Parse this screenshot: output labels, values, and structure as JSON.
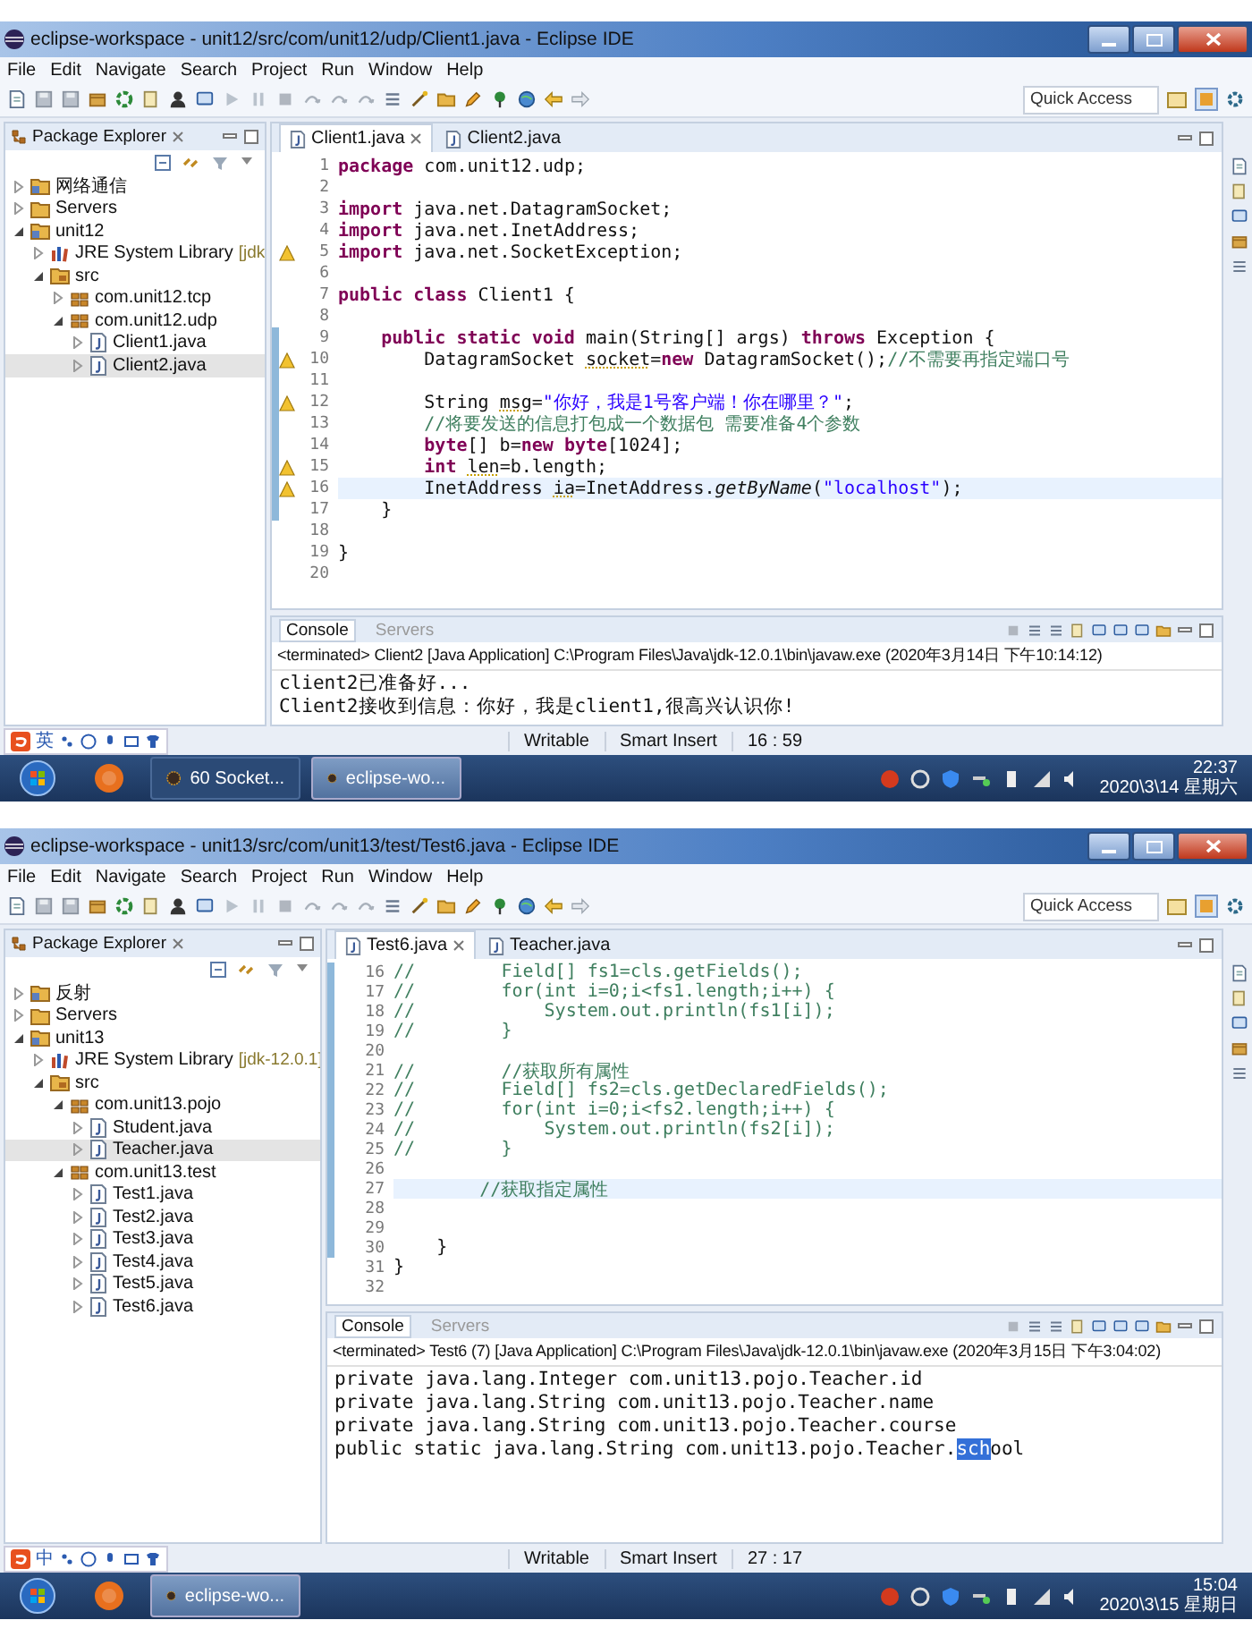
{
  "screens": [
    {
      "window": {
        "title": "eclipse-workspace - unit12/src/com/unit12/udp/Client1.java - Eclipse IDE"
      },
      "menu": [
        "File",
        "Edit",
        "Navigate",
        "Search",
        "Project",
        "Run",
        "Window",
        "Help"
      ],
      "quick_access": {
        "placeholder": "Quick Access"
      },
      "package_explorer": {
        "title": "Package Explorer",
        "tree": [
          {
            "label": "网络通信",
            "kind": "project",
            "expanded": false,
            "selected": false
          },
          {
            "label": "Servers",
            "kind": "folder",
            "expanded": false,
            "selected": false
          },
          {
            "label": "unit12",
            "kind": "project",
            "expanded": true,
            "selected": false,
            "children": [
              {
                "label": "JRE System Library",
                "decoration": "[jdk",
                "kind": "library",
                "expanded": false,
                "selected": false
              },
              {
                "label": "src",
                "kind": "source",
                "expanded": true,
                "selected": false,
                "children": [
                  {
                    "label": "com.unit12.tcp",
                    "kind": "package",
                    "expanded": false,
                    "selected": false
                  },
                  {
                    "label": "com.unit12.udp",
                    "kind": "package",
                    "expanded": true,
                    "selected": false,
                    "children": [
                      {
                        "label": "Client1.java",
                        "kind": "file",
                        "expanded": false,
                        "selected": false
                      },
                      {
                        "label": "Client2.java",
                        "kind": "file",
                        "expanded": false,
                        "selected": true
                      }
                    ]
                  }
                ]
              }
            ]
          }
        ]
      },
      "editor": {
        "tabs": [
          {
            "label": "Client1.java",
            "selected": true
          },
          {
            "label": "Client2.java",
            "selected": false
          }
        ],
        "lines": [
          {
            "n": "1",
            "warning": false,
            "changed": false,
            "selected": false,
            "tokens": [
              {
                "kind": "kw",
                "text": "package"
              },
              {
                "kind": "plain",
                "text": " com.unit12.udp;"
              }
            ]
          },
          {
            "n": "2",
            "warning": false,
            "changed": false,
            "selected": false
          },
          {
            "n": "3",
            "warning": false,
            "changed": false,
            "selected": false,
            "tokens": [
              {
                "kind": "kw",
                "text": "import"
              },
              {
                "kind": "plain",
                "text": " java.net.DatagramSocket;"
              }
            ]
          },
          {
            "n": "4",
            "warning": false,
            "changed": false,
            "selected": false,
            "tokens": [
              {
                "kind": "kw",
                "text": "import"
              },
              {
                "kind": "plain",
                "text": " java.net.InetAddress;"
              }
            ]
          },
          {
            "n": "5",
            "warning": true,
            "changed": false,
            "selected": false,
            "tokens": [
              {
                "kind": "kw",
                "text": "import"
              },
              {
                "kind": "plain",
                "text": " java.net.SocketException;"
              }
            ]
          },
          {
            "n": "6",
            "warning": false,
            "changed": false,
            "selected": false
          },
          {
            "n": "7",
            "warning": false,
            "changed": false,
            "selected": false,
            "tokens": [
              {
                "kind": "kw",
                "text": "public class"
              },
              {
                "kind": "plain",
                "text": " Client1 {"
              }
            ]
          },
          {
            "n": "8",
            "warning": false,
            "changed": false,
            "selected": false
          },
          {
            "n": "9",
            "warning": false,
            "changed": true,
            "selected": false,
            "tokens": [
              {
                "kind": "kw",
                "text": "    public static void"
              },
              {
                "kind": "plain",
                "text": " main(String[] args) "
              },
              {
                "kind": "kw",
                "text": "throws"
              },
              {
                "kind": "plain",
                "text": " Exception {"
              }
            ]
          },
          {
            "n": "10",
            "warning": true,
            "changed": true,
            "selected": false,
            "tokens": [
              {
                "kind": "plain",
                "text": "        DatagramSocket "
              },
              {
                "kind": "unused",
                "text": "socket"
              },
              {
                "kind": "plain",
                "text": "="
              },
              {
                "kind": "kw",
                "text": "new"
              },
              {
                "kind": "plain",
                "text": " DatagramSocket();"
              },
              {
                "kind": "comment",
                "text": "//不需要再指定端口号"
              }
            ]
          },
          {
            "n": "11",
            "warning": false,
            "changed": true,
            "selected": false
          },
          {
            "n": "12",
            "warning": true,
            "changed": true,
            "selected": false,
            "tokens": [
              {
                "kind": "plain",
                "text": "        String "
              },
              {
                "kind": "unused",
                "text": "msg"
              },
              {
                "kind": "plain",
                "text": "="
              },
              {
                "kind": "string",
                "text": "\"你好，我是1号客户端！你在哪里？\""
              },
              {
                "kind": "plain",
                "text": ";"
              }
            ]
          },
          {
            "n": "13",
            "warning": false,
            "changed": true,
            "selected": false,
            "tokens": [
              {
                "kind": "comment",
                "text": "        //将要发送的信息打包成一个数据包 需要准备4个参数"
              }
            ]
          },
          {
            "n": "14",
            "warning": false,
            "changed": true,
            "selected": false,
            "tokens": [
              {
                "kind": "kw",
                "text": "        byte"
              },
              {
                "kind": "plain",
                "text": "[] b="
              },
              {
                "kind": "kw",
                "text": "new byte"
              },
              {
                "kind": "plain",
                "text": "[1024];"
              }
            ]
          },
          {
            "n": "15",
            "warning": true,
            "changed": true,
            "selected": false,
            "tokens": [
              {
                "kind": "kw",
                "text": "        int "
              },
              {
                "kind": "unused",
                "text": "len"
              },
              {
                "kind": "plain",
                "text": "=b.length;"
              }
            ]
          },
          {
            "n": "16",
            "warning": true,
            "changed": true,
            "selected": true,
            "tokens": [
              {
                "kind": "plain",
                "text": "        InetAddress "
              },
              {
                "kind": "unused",
                "text": "ia"
              },
              {
                "kind": "plain",
                "text": "=InetAddress."
              },
              {
                "kind": "italic",
                "text": "getByName"
              },
              {
                "kind": "plain",
                "text": "("
              },
              {
                "kind": "string",
                "text": "\"localhost\""
              },
              {
                "kind": "plain",
                "text": ");"
              }
            ]
          },
          {
            "n": "17",
            "warning": false,
            "changed": true,
            "selected": false,
            "tokens": [
              {
                "kind": "plain",
                "text": "    }"
              }
            ]
          },
          {
            "n": "18",
            "warning": false,
            "changed": false,
            "selected": false
          },
          {
            "n": "19",
            "warning": false,
            "changed": false,
            "selected": false,
            "tokens": [
              {
                "kind": "plain",
                "text": "}"
              }
            ]
          },
          {
            "n": "20",
            "warning": false,
            "changed": false,
            "selected": false
          }
        ]
      },
      "console": {
        "tabs": [
          {
            "label": "Console",
            "selected": true
          },
          {
            "label": "Servers",
            "selected": false
          }
        ],
        "header": "<terminated> Client2 [Java Application] C:\\Program Files\\Java\\jdk-12.0.1\\bin\\javaw.exe (2020年3月14日 下午10:14:12)",
        "output": [
          {
            "segments": [
              {
                "text": "client2已准备好...",
                "selected": false
              }
            ]
          },
          {
            "segments": [
              {
                "text": "Client2接收到信息：你好，我是client1,很高兴认识你!",
                "selected": false
              }
            ]
          }
        ]
      },
      "status_bar": {
        "ime": {
          "mode": "英"
        },
        "items": [
          "Writable",
          "Smart Insert",
          "16 : 59"
        ]
      },
      "taskbar": {
        "tasks": [
          {
            "label": "60 Socket...",
            "selected": false
          },
          {
            "label": "eclipse-wo...",
            "selected": true
          }
        ],
        "clock": {
          "time": "22:37",
          "date": "2020\\3\\14 星期六"
        }
      }
    },
    {
      "window": {
        "title": "eclipse-workspace - unit13/src/com/unit13/test/Test6.java - Eclipse IDE"
      },
      "menu": [
        "File",
        "Edit",
        "Navigate",
        "Search",
        "Project",
        "Run",
        "Window",
        "Help"
      ],
      "quick_access": {
        "placeholder": "Quick Access"
      },
      "package_explorer": {
        "title": "Package Explorer",
        "tree": [
          {
            "label": "反射",
            "kind": "project",
            "expanded": false,
            "selected": false
          },
          {
            "label": "Servers",
            "kind": "folder",
            "expanded": false,
            "selected": false
          },
          {
            "label": "unit13",
            "kind": "project",
            "expanded": true,
            "selected": false,
            "children": [
              {
                "label": "JRE System Library",
                "decoration": "[jdk-12.0.1]",
                "kind": "library",
                "expanded": false,
                "selected": false
              },
              {
                "label": "src",
                "kind": "source",
                "expanded": true,
                "selected": false,
                "children": [
                  {
                    "label": "com.unit13.pojo",
                    "kind": "package",
                    "expanded": true,
                    "selected": false,
                    "children": [
                      {
                        "label": "Student.java",
                        "kind": "file",
                        "expanded": false,
                        "selected": false
                      },
                      {
                        "label": "Teacher.java",
                        "kind": "file",
                        "expanded": false,
                        "selected": true
                      }
                    ]
                  },
                  {
                    "label": "com.unit13.test",
                    "kind": "package",
                    "expanded": true,
                    "selected": false,
                    "children": [
                      {
                        "label": "Test1.java",
                        "kind": "file",
                        "expanded": false,
                        "selected": false
                      },
                      {
                        "label": "Test2.java",
                        "kind": "file",
                        "expanded": false,
                        "selected": false
                      },
                      {
                        "label": "Test3.java",
                        "kind": "file",
                        "expanded": false,
                        "selected": false
                      },
                      {
                        "label": "Test4.java",
                        "kind": "file",
                        "expanded": false,
                        "selected": false
                      },
                      {
                        "label": "Test5.java",
                        "kind": "file",
                        "expanded": false,
                        "selected": false
                      },
                      {
                        "label": "Test6.java",
                        "kind": "file",
                        "expanded": false,
                        "selected": false
                      }
                    ]
                  }
                ]
              }
            ]
          }
        ]
      },
      "editor": {
        "tabs": [
          {
            "label": "Test6.java",
            "selected": true
          },
          {
            "label": "Teacher.java",
            "selected": false
          }
        ],
        "lines": [
          {
            "n": "16",
            "warning": false,
            "changed": true,
            "selected": false,
            "tokens": [
              {
                "kind": "comment",
                "text": "//        Field[] fs1=cls.getFields();"
              }
            ]
          },
          {
            "n": "17",
            "warning": false,
            "changed": true,
            "selected": false,
            "tokens": [
              {
                "kind": "comment",
                "text": "//        for(int i=0;i<fs1.length;i++) {"
              }
            ]
          },
          {
            "n": "18",
            "warning": false,
            "changed": true,
            "selected": false,
            "tokens": [
              {
                "kind": "comment",
                "text": "//            System.out.println(fs1[i]);"
              }
            ]
          },
          {
            "n": "19",
            "warning": false,
            "changed": true,
            "selected": false,
            "tokens": [
              {
                "kind": "comment",
                "text": "//        }"
              }
            ]
          },
          {
            "n": "20",
            "warning": false,
            "changed": true,
            "selected": false
          },
          {
            "n": "21",
            "warning": false,
            "changed": true,
            "selected": false,
            "tokens": [
              {
                "kind": "comment",
                "text": "//        //获取所有属性"
              }
            ]
          },
          {
            "n": "22",
            "warning": false,
            "changed": true,
            "selected": false,
            "tokens": [
              {
                "kind": "comment",
                "text": "//        Field[] fs2=cls.getDeclaredFields();"
              }
            ]
          },
          {
            "n": "23",
            "warning": false,
            "changed": true,
            "selected": false,
            "tokens": [
              {
                "kind": "comment",
                "text": "//        for(int i=0;i<fs2.length;i++) {"
              }
            ]
          },
          {
            "n": "24",
            "warning": false,
            "changed": true,
            "selected": false,
            "tokens": [
              {
                "kind": "comment",
                "text": "//            System.out.println(fs2[i]);"
              }
            ]
          },
          {
            "n": "25",
            "warning": false,
            "changed": true,
            "selected": false,
            "tokens": [
              {
                "kind": "comment",
                "text": "//        }"
              }
            ]
          },
          {
            "n": "26",
            "warning": false,
            "changed": true,
            "selected": false
          },
          {
            "n": "27",
            "warning": false,
            "changed": true,
            "selected": true,
            "tokens": [
              {
                "kind": "comment",
                "text": "        //获取指定属性"
              }
            ]
          },
          {
            "n": "28",
            "warning": false,
            "changed": true,
            "selected": false
          },
          {
            "n": "29",
            "warning": false,
            "changed": true,
            "selected": false
          },
          {
            "n": "30",
            "warning": false,
            "changed": true,
            "selected": false,
            "tokens": [
              {
                "kind": "plain",
                "text": "    }"
              }
            ]
          },
          {
            "n": "31",
            "warning": false,
            "changed": false,
            "selected": false,
            "tokens": [
              {
                "kind": "plain",
                "text": "}"
              }
            ]
          },
          {
            "n": "32",
            "warning": false,
            "changed": false,
            "selected": false
          }
        ]
      },
      "console": {
        "tabs": [
          {
            "label": "Console",
            "selected": true
          },
          {
            "label": "Servers",
            "selected": false
          }
        ],
        "header": "<terminated> Test6 (7) [Java Application] C:\\Program Files\\Java\\jdk-12.0.1\\bin\\javaw.exe (2020年3月15日 下午3:04:02)",
        "output": [
          {
            "segments": [
              {
                "text": "private java.lang.Integer com.unit13.pojo.Teacher.id",
                "selected": false
              }
            ]
          },
          {
            "segments": [
              {
                "text": "private java.lang.String com.unit13.pojo.Teacher.name",
                "selected": false
              }
            ]
          },
          {
            "segments": [
              {
                "text": "private java.lang.String com.unit13.pojo.Teacher.course",
                "selected": false
              }
            ]
          },
          {
            "segments": [
              {
                "text": "public static java.lang.String com.unit13.pojo.Teacher.",
                "selected": false
              },
              {
                "text": "sch",
                "selected": true
              },
              {
                "text": "ool",
                "selected": false
              }
            ]
          }
        ]
      },
      "status_bar": {
        "ime": {
          "mode": "中"
        },
        "items": [
          "Writable",
          "Smart Insert",
          "27 : 17"
        ]
      },
      "taskbar": {
        "tasks": [
          {
            "label": "eclipse-wo...",
            "selected": true
          }
        ],
        "clock": {
          "time": "15:04",
          "date": "2020\\3\\15 星期日"
        }
      }
    }
  ]
}
